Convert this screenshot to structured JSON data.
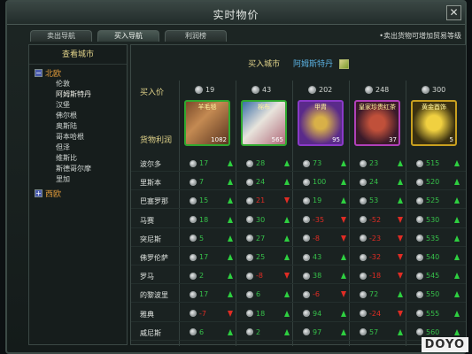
{
  "window": {
    "title": "实时物价",
    "close": "✕"
  },
  "tabs": [
    "卖出导航",
    "买入导航",
    "利润榜"
  ],
  "hint": "•卖出货物可增加贸易等级",
  "left": {
    "header": "查看城市",
    "groups": [
      {
        "toggle": "−",
        "name": "北欧",
        "cities": [
          "伦敦",
          "阿姆斯特丹",
          "汉堡",
          "佛尔根",
          "奥斯陆",
          "哥本哈根",
          "但泽",
          "维斯比",
          "斯德哥尔摩",
          "里加"
        ]
      },
      {
        "toggle": "+",
        "name": "西欧",
        "cities": []
      }
    ]
  },
  "right": {
    "buy_city_label": "买入城市",
    "buy_city_value": "阿姆斯特丹",
    "price_label": "买入价",
    "profit_label": "货物利润",
    "items": [
      {
        "name": "羊毛毯",
        "price": "19",
        "qty": "1082",
        "color": "#2fa82f"
      },
      {
        "name": "棉布",
        "price": "43",
        "qty": "565",
        "color": "#2fa82f"
      },
      {
        "name": "甲胄",
        "price": "202",
        "qty": "95",
        "color": "#8a3ac8"
      },
      {
        "name": "皇家珍贵红茶",
        "price": "248",
        "qty": "37",
        "color": "#b040b8"
      },
      {
        "name": "黄金首饰",
        "price": "300",
        "qty": "5",
        "color": "#c8a020"
      }
    ],
    "rows": [
      {
        "city": "波尔多",
        "cells": [
          [
            "17",
            "up"
          ],
          [
            "28",
            "up"
          ],
          [
            "73",
            "up"
          ],
          [
            "23",
            "up"
          ],
          [
            "515",
            "up"
          ]
        ]
      },
      {
        "city": "里斯本",
        "cells": [
          [
            "7",
            "up"
          ],
          [
            "24",
            "up"
          ],
          [
            "100",
            "up"
          ],
          [
            "24",
            "up"
          ],
          [
            "520",
            "up"
          ]
        ]
      },
      {
        "city": "巴塞罗那",
        "cells": [
          [
            "15",
            "up"
          ],
          [
            "21",
            "down"
          ],
          [
            "19",
            "up"
          ],
          [
            "53",
            "up"
          ],
          [
            "525",
            "up"
          ]
        ]
      },
      {
        "city": "马赛",
        "cells": [
          [
            "18",
            "up"
          ],
          [
            "30",
            "up"
          ],
          [
            "-35",
            "down"
          ],
          [
            "-52",
            "down"
          ],
          [
            "530",
            "up"
          ]
        ]
      },
      {
        "city": "突尼斯",
        "cells": [
          [
            "5",
            "up"
          ],
          [
            "27",
            "up"
          ],
          [
            "-8",
            "down"
          ],
          [
            "-23",
            "down"
          ],
          [
            "535",
            "up"
          ]
        ]
      },
      {
        "city": "佛罗伦萨",
        "cells": [
          [
            "17",
            "up"
          ],
          [
            "25",
            "up"
          ],
          [
            "43",
            "up"
          ],
          [
            "-32",
            "down"
          ],
          [
            "540",
            "up"
          ]
        ]
      },
      {
        "city": "罗马",
        "cells": [
          [
            "2",
            "up"
          ],
          [
            "-8",
            "down"
          ],
          [
            "38",
            "up"
          ],
          [
            "-18",
            "down"
          ],
          [
            "545",
            "up"
          ]
        ]
      },
      {
        "city": "的黎波里",
        "cells": [
          [
            "17",
            "up"
          ],
          [
            "6",
            "up"
          ],
          [
            "-6",
            "down"
          ],
          [
            "72",
            "up"
          ],
          [
            "550",
            "up"
          ]
        ]
      },
      {
        "city": "雅典",
        "cells": [
          [
            "-7",
            "down"
          ],
          [
            "18",
            "up"
          ],
          [
            "94",
            "up"
          ],
          [
            "-24",
            "down"
          ],
          [
            "555",
            "up"
          ]
        ]
      },
      {
        "city": "威尼斯",
        "cells": [
          [
            "6",
            "up"
          ],
          [
            "2",
            "up"
          ],
          [
            "97",
            "up"
          ],
          [
            "57",
            "up"
          ],
          [
            "560",
            "up"
          ]
        ]
      }
    ]
  },
  "watermark": "DOYO"
}
